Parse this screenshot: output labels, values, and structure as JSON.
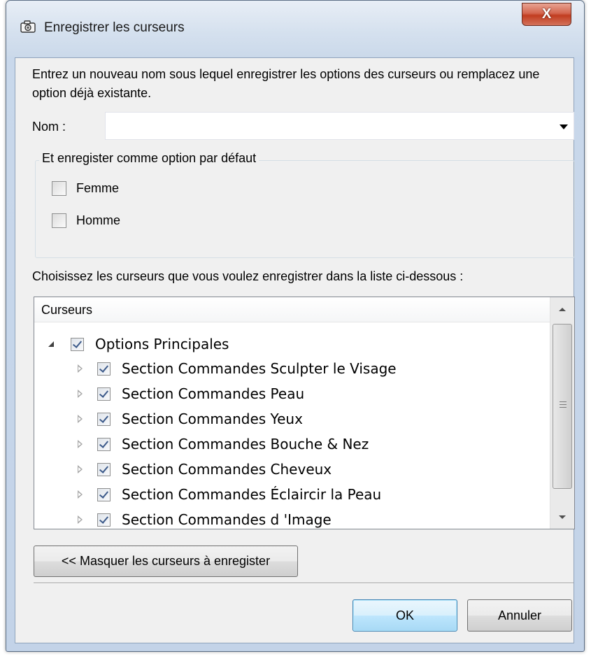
{
  "window": {
    "title": "Enregistrer les curseurs",
    "close_label": "X"
  },
  "description": "Entrez un nouveau nom sous lequel enregistrer les options des curseurs ou remplacez une option déjà existante.",
  "name_field": {
    "label": "Nom :",
    "value": ""
  },
  "default_group": {
    "title": "Et enregister comme option par défaut",
    "options": [
      {
        "label": "Femme",
        "checked": false
      },
      {
        "label": "Homme",
        "checked": false
      }
    ]
  },
  "choose_label": "Choisissez les curseurs que vous voulez enregistrer dans la liste ci-dessous :",
  "tree": {
    "header": "Curseurs",
    "root": {
      "label": "Options Principales",
      "checked": true,
      "expanded": true
    },
    "children": [
      {
        "label": "Section Commandes Sculpter le Visage",
        "checked": true
      },
      {
        "label": "Section Commandes Peau",
        "checked": true
      },
      {
        "label": "Section Commandes Yeux",
        "checked": true
      },
      {
        "label": "Section Commandes Bouche & Nez",
        "checked": true
      },
      {
        "label": "Section Commandes Cheveux",
        "checked": true
      },
      {
        "label": "Section Commandes Éclaircir la Peau",
        "checked": true
      },
      {
        "label": "Section Commandes d 'Image",
        "checked": true
      }
    ]
  },
  "buttons": {
    "hide": "<< Masquer les curseurs à enregister",
    "ok": "OK",
    "cancel": "Annuler"
  },
  "icons": {
    "title": "camera-icon",
    "close": "close-icon"
  },
  "colors": {
    "close_button": "#c13d20",
    "ok_button": "#bee6fd",
    "checkmark": "#3c5a8a"
  }
}
